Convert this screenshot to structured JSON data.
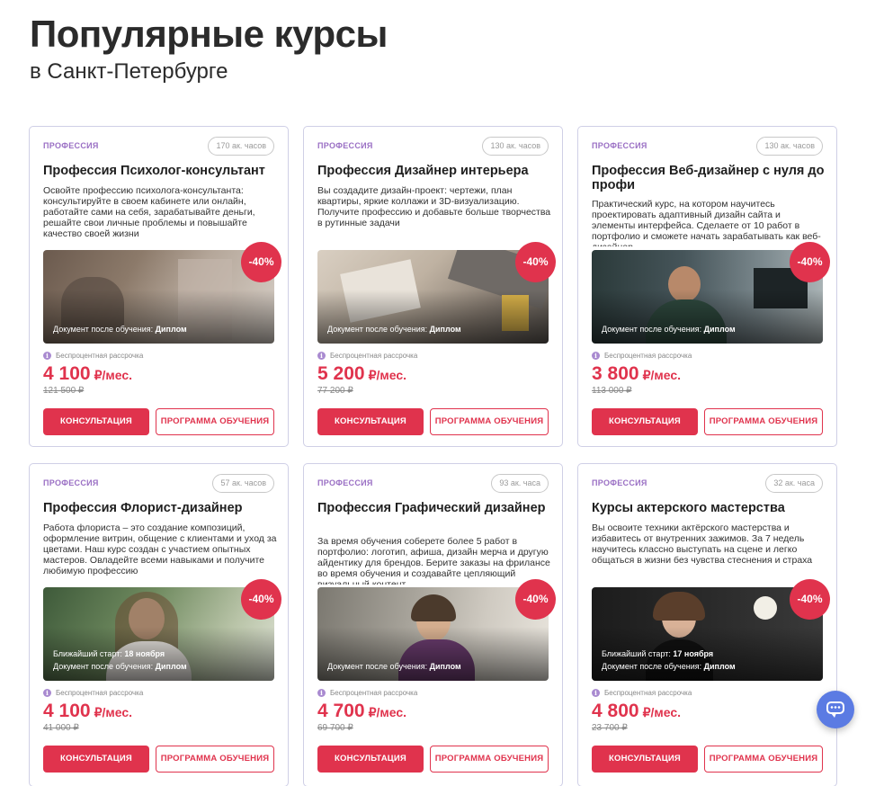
{
  "header": {
    "title": "Популярные курсы",
    "subtitle": "в Санкт-Петербурге"
  },
  "common": {
    "kind": "ПРОФЕССИЯ",
    "installment": "Беспроцентная рассрочка",
    "doc_label": "Документ после обучения:",
    "doc_value": "Диплом",
    "start_label": "Ближайший старт:",
    "price_unit": "₽/мес.",
    "consult_label": "КОНСУЛЬТАЦИЯ",
    "program_label": "ПРОГРАММА ОБУЧЕНИЯ"
  },
  "cards": [
    {
      "kind": "ПРОФЕССИЯ",
      "hours": "170 ак. часов",
      "title": "Профессия Психолог-консультант",
      "description": "Освойте профессию психолога-консультанта: консультируйте в своем кабинете или онлайн, работайте сами на себя, зарабатывайте деньги, решайте свои личные проблемы и повышайте качество своей жизни",
      "discount": "-40%",
      "price": "4 100",
      "old_price": "121 500 ₽",
      "start": null
    },
    {
      "kind": "ПРОФЕССИЯ",
      "hours": "130 ак. часов",
      "title": "Профессия Дизайнер интерьера",
      "description": "Вы создадите дизайн-проект: чертежи, план квартиры, яркие коллажи и 3D-визуализацию. Получите профессию и добавьте больше творчества в рутинные задачи",
      "discount": "-40%",
      "price": "5 200",
      "old_price": "77 200 ₽",
      "start": null
    },
    {
      "kind": "ПРОФЕССИЯ",
      "hours": "130 ак. часов",
      "title": "Профессия Веб-дизайнер с нуля до профи",
      "description": "Практический курс, на котором научитесь проектировать адаптивный дизайн сайта и элементы интерфейса. Сделаете от 10 работ в портфолио и сможете начать зарабатывать как веб-дизайнер",
      "discount": "-40%",
      "price": "3 800",
      "old_price": "113 000 ₽",
      "start": null
    },
    {
      "kind": "ПРОФЕССИЯ",
      "hours": "57 ак. часов",
      "title": "Профессия Флорист-дизайнер",
      "description": "Работа флориста – это создание композиций, оформление витрин, общение с клиентами и уход за цветами. Наш курс создан с участием опытных мастеров. Овладейте всеми навыками и получите любимую профессию",
      "discount": "-40%",
      "price": "4 100",
      "old_price": "41 000 ₽",
      "start": "18 ноября"
    },
    {
      "kind": "ПРОФЕССИЯ",
      "hours": "93 ак. часа",
      "title": "Профессия Графический дизайнер",
      "description": "За время обучения соберете более 5 работ в портфолио: логотип, афиша, дизайн мерча и другую айдентику для брендов. Берите заказы на фрилансе во время обучения и создавайте цепляющий визуальный контент",
      "discount": "-40%",
      "price": "4 700",
      "old_price": "69 700 ₽",
      "start": null
    },
    {
      "kind": "ПРОФЕССИЯ",
      "hours": "32 ак. часа",
      "title": "Курсы актерского мастерства",
      "description": "Вы освоите техники актёрского мастерства и избавитесь от внутренних зажимов. За 7 недель научитесь классно выступать на сцене и легко общаться в жизни без чувства стеснения и страха",
      "discount": "-40%",
      "price": "4 800",
      "old_price": "23 700 ₽",
      "start": "17 ноября"
    }
  ],
  "colors": {
    "accent": "#e0334d",
    "kind_label": "#9a6fc4",
    "chat": "#5b7be3"
  }
}
